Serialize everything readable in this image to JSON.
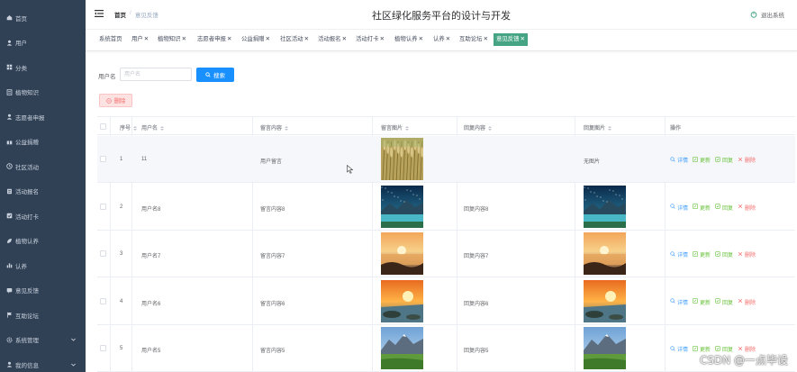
{
  "app": {
    "title": "社区绿化服务平台的设计与开发",
    "logout_label": "退出系统"
  },
  "breadcrumb": {
    "home": "首页",
    "current": "意见反馈"
  },
  "sidebar": {
    "items": [
      {
        "label": "首页",
        "icon": "home-icon"
      },
      {
        "label": "用户",
        "icon": "user-icon"
      },
      {
        "label": "分类",
        "icon": "category-icon"
      },
      {
        "label": "植物知识",
        "icon": "book-icon"
      },
      {
        "label": "志愿者申报",
        "icon": "user-icon"
      },
      {
        "label": "公益捐赠",
        "icon": "gift-icon"
      },
      {
        "label": "社区活动",
        "icon": "activity-icon"
      },
      {
        "label": "活动报名",
        "icon": "form-icon"
      },
      {
        "label": "活动打卡",
        "icon": "check-icon"
      },
      {
        "label": "植物认养",
        "icon": "leaf-icon"
      },
      {
        "label": "认养",
        "icon": "chart-icon"
      },
      {
        "label": "意见反馈",
        "icon": "message-icon"
      },
      {
        "label": "互助论坛",
        "icon": "flag-icon"
      },
      {
        "label": "系统管理",
        "icon": "settings-icon",
        "expandable": true
      },
      {
        "label": "我的信息",
        "icon": "user-icon",
        "expandable": true
      }
    ]
  },
  "tags": [
    {
      "label": "系统首页",
      "closable": false
    },
    {
      "label": "用户",
      "closable": true
    },
    {
      "label": "植物知识",
      "closable": true
    },
    {
      "label": "志愿者申报",
      "closable": true
    },
    {
      "label": "公益捐赠",
      "closable": true
    },
    {
      "label": "社区活动",
      "closable": true
    },
    {
      "label": "活动报名",
      "closable": true
    },
    {
      "label": "活动打卡",
      "closable": true
    },
    {
      "label": "植物认养",
      "closable": true
    },
    {
      "label": "认养",
      "closable": true
    },
    {
      "label": "互助论坛",
      "closable": true
    },
    {
      "label": "意见反馈",
      "closable": true,
      "active": true
    }
  ],
  "search": {
    "label": "用户名",
    "placeholder": "用户名",
    "value": "",
    "button_label": "搜索"
  },
  "toolbar": {
    "delete_label": "删除"
  },
  "table": {
    "columns": [
      "序号",
      "用户名",
      "留言内容",
      "留言图片",
      "回复内容",
      "回复图片",
      "操作"
    ],
    "rows": [
      {
        "index": "1",
        "username": "11",
        "message": "用户留言",
        "message_image": "wheat",
        "reply": "",
        "reply_image": "",
        "reply_image_text": "无图片"
      },
      {
        "index": "2",
        "username": "用户名8",
        "message": "留言内容8",
        "message_image": "night-lake",
        "reply": "回复内容8",
        "reply_image": "night-lake",
        "reply_image_text": ""
      },
      {
        "index": "3",
        "username": "用户名7",
        "message": "留言内容7",
        "message_image": "sunset",
        "reply": "回复内容7",
        "reply_image": "sunset",
        "reply_image_text": ""
      },
      {
        "index": "4",
        "username": "用户名6",
        "message": "留言内容6",
        "message_image": "sunrise",
        "reply": "回复内容6",
        "reply_image": "sunrise",
        "reply_image_text": ""
      },
      {
        "index": "5",
        "username": "用户名5",
        "message": "留言内容5",
        "message_image": "mountain",
        "reply": "回复内容5",
        "reply_image": "mountain",
        "reply_image_text": ""
      }
    ],
    "actions": {
      "detail": "详情",
      "update": "更新",
      "reply": "回复",
      "remove": "删除"
    }
  },
  "watermark": "CSDN @一点毕设",
  "colors": {
    "sidebar_bg": "#304156",
    "primary": "#1890ff",
    "active_tag": "#45a484",
    "danger": "#f56c6c",
    "success": "#67c23a",
    "info": "#409eff"
  }
}
